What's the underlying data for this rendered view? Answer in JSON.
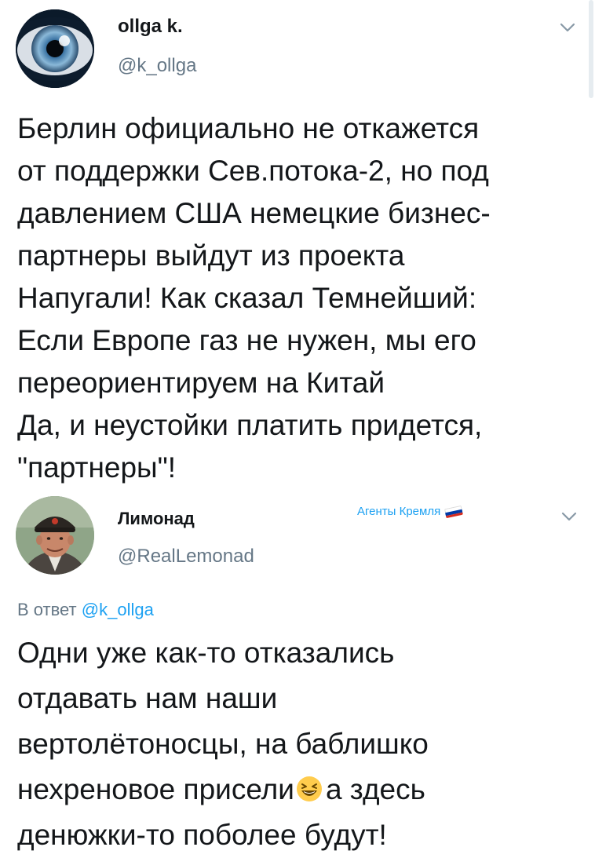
{
  "tweets": [
    {
      "author_name": "ollga k.",
      "author_handle": "@k_ollga",
      "avatar_icon": "eye-avatar",
      "menu_icon": "chevron-down-icon",
      "text_lines": [
        "Берлин официально не откажется",
        "от поддержки Сев.потока-2, но под",
        "давлением США немецкие бизнес-",
        "партнеры выйдут из проекта",
        "Напугали! Как сказал Темнейший:",
        "Если Европе газ не нужен, мы его",
        "переориентируем на Китай",
        "Да, и неустойки платить придется,",
        "\"партнеры\"!"
      ]
    },
    {
      "author_name": "Лимонад",
      "author_handle": "@RealLemonad",
      "avatar_icon": "man-in-hat-avatar",
      "badge_text": "Агенты Кремля",
      "badge_icon": "russian-flag-icon",
      "menu_icon": "chevron-down-icon",
      "reply_prefix": "В ответ",
      "reply_mention": "@k_ollga",
      "text_lines": [
        "Одни уже как-то отказались",
        "отдавать нам наши",
        "вертолётоносцы, на баблишко"
      ],
      "line4_before_emoji": "нехреновое присели",
      "emoji_icon": "laughing-face-emoji",
      "line4_after_emoji": "а здесь",
      "line5": "денюжки-то поболее будут!"
    }
  ],
  "colors": {
    "text": "#14171a",
    "secondary": "#657786",
    "accent": "#1da1f2",
    "flag": [
      "#ffffff",
      "#0039a6",
      "#d52b1e"
    ]
  }
}
